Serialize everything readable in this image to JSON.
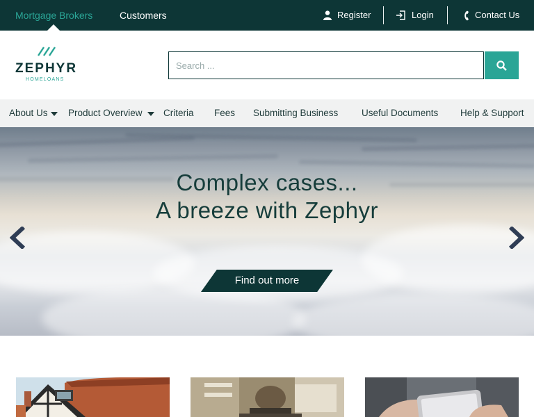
{
  "topbar": {
    "audiences": [
      {
        "label": "Mortgage Brokers",
        "active": true
      },
      {
        "label": "Customers",
        "active": false
      }
    ],
    "links": [
      {
        "label": "Register",
        "icon": "user-icon"
      },
      {
        "label": "Login",
        "icon": "login-icon"
      },
      {
        "label": "Contact Us",
        "icon": "phone-icon"
      }
    ]
  },
  "brand": {
    "name": "ZEPHYR",
    "tagline": "HOMELOANS",
    "colors": {
      "primary": "#0d3636",
      "accent": "#2aa596"
    }
  },
  "search": {
    "placeholder": "Search ...",
    "value": "",
    "button_icon": "search-icon"
  },
  "nav": {
    "items": [
      {
        "label": "About Us",
        "has_dropdown": true
      },
      {
        "label": "Product Overview",
        "has_dropdown": true
      },
      {
        "label": "Criteria",
        "has_dropdown": false
      },
      {
        "label": "Fees",
        "has_dropdown": false
      },
      {
        "label": "Submitting Business",
        "has_dropdown": false
      },
      {
        "label": "Useful Documents",
        "has_dropdown": false
      },
      {
        "label": "Help & Support",
        "has_dropdown": false
      }
    ]
  },
  "hero": {
    "headline_line1": "Complex cases...",
    "headline_line2": "A breeze with Zephyr",
    "cta_label": "Find out more",
    "prev_icon": "chevron-left-icon",
    "next_icon": "chevron-right-icon"
  },
  "cards": [
    {
      "image": "house-photo"
    },
    {
      "image": "office-photo"
    },
    {
      "image": "phone-photo"
    }
  ]
}
